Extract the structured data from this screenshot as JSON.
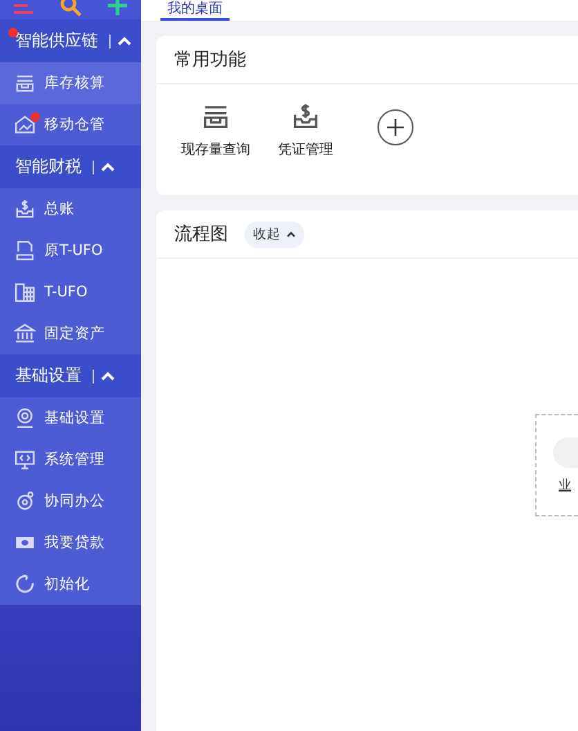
{
  "sidebar": {
    "groups": [
      {
        "title": "智能供应链",
        "expanded": true,
        "alert": true,
        "items": [
          {
            "label": "库存核算",
            "kind": "stack",
            "selected": true,
            "alert": false
          },
          {
            "label": "移动仓管",
            "kind": "warehouse",
            "selected": false,
            "alert": true
          }
        ]
      },
      {
        "title": "智能财税",
        "expanded": true,
        "alert": false,
        "items": [
          {
            "label": "总账",
            "kind": "ledger",
            "selected": false,
            "alert": false
          },
          {
            "label": "原T-UFO",
            "kind": "ufo",
            "selected": false,
            "alert": false
          },
          {
            "label": "T-UFO",
            "kind": "sheet",
            "selected": false,
            "alert": false
          },
          {
            "label": "固定资产",
            "kind": "bank",
            "selected": false,
            "alert": false
          }
        ]
      },
      {
        "title": "基础设置",
        "expanded": true,
        "alert": false,
        "items": [
          {
            "label": "基础设置",
            "kind": "gear",
            "selected": false,
            "alert": false
          },
          {
            "label": "系统管理",
            "kind": "monitor",
            "selected": false,
            "alert": false
          },
          {
            "label": "协同办公",
            "kind": "orbit",
            "selected": false,
            "alert": false
          },
          {
            "label": "我要贷款",
            "kind": "cash",
            "selected": false,
            "alert": false
          },
          {
            "label": "初始化",
            "kind": "reset",
            "selected": false,
            "alert": false
          }
        ]
      }
    ]
  },
  "tabs": [
    {
      "label": "我的桌面",
      "selected": true
    }
  ],
  "quick_functions": {
    "title": "常用功能",
    "items": [
      {
        "label": "现存量查询",
        "kind": "stack"
      },
      {
        "label": "凭证管理",
        "kind": "ledger"
      }
    ]
  },
  "flowchart": {
    "title": "流程图",
    "toggle": "收起",
    "expanded": true,
    "node_label": "业"
  }
}
